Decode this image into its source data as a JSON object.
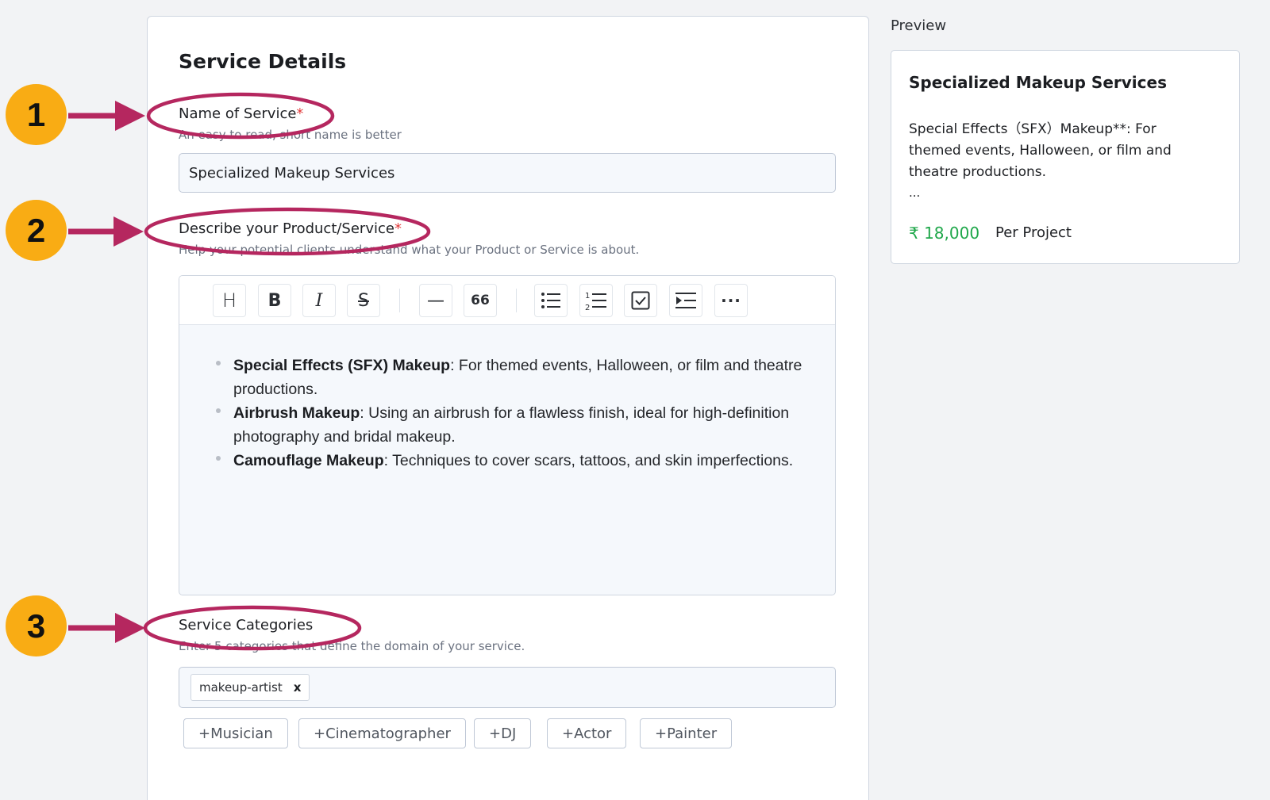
{
  "form": {
    "title": "Service Details",
    "name_field": {
      "label": "Name of Service",
      "required_mark": "*",
      "hint": "An easy to read, short name is better",
      "value": "Specialized Makeup Services"
    },
    "description_field": {
      "label": "Describe your Product/Service",
      "required_mark": "*",
      "hint": "Help your potential clients understand what your Product or Service is about.",
      "toolbar": [
        {
          "name": "heading",
          "glyph": "H"
        },
        {
          "name": "bold",
          "glyph": "B"
        },
        {
          "name": "italic",
          "glyph": "I"
        },
        {
          "name": "strikethrough",
          "glyph": "S"
        },
        {
          "name": "horizontal-rule",
          "glyph": "—"
        },
        {
          "name": "quote",
          "glyph": "66"
        },
        {
          "name": "bullet-list",
          "glyph": ""
        },
        {
          "name": "numbered-list",
          "glyph": ""
        },
        {
          "name": "checklist",
          "glyph": ""
        },
        {
          "name": "indent",
          "glyph": ""
        },
        {
          "name": "more",
          "glyph": "···"
        }
      ],
      "items": [
        {
          "bold": "Special Effects (SFX) Makeup",
          "rest": ": For themed events, Halloween, or film and theatre productions."
        },
        {
          "bold": "Airbrush Makeup",
          "rest": ": Using an airbrush for a flawless finish, ideal for high-definition photography and bridal makeup."
        },
        {
          "bold": "Camouflage Makeup",
          "rest": ": Techniques to cover scars, tattoos, and skin imperfections."
        }
      ]
    },
    "categories_field": {
      "label": "Service Categories",
      "hint": "Enter 5 categories that define the domain of your service.",
      "tags": [
        {
          "label": "makeup-artist",
          "remove": "x"
        }
      ],
      "suggestions": [
        "+Musician",
        "+Cinematographer",
        "+DJ",
        "+Actor",
        "+Painter"
      ]
    }
  },
  "preview": {
    "label": "Preview",
    "title": "Specialized Makeup Services",
    "description": "Special Effects（SFX）Makeup**: For themed events, Halloween, or film and theatre productions.",
    "ellipsis": "...",
    "price": "₹ 18,000",
    "unit": "Per Project"
  },
  "annotations": {
    "markers": [
      "1",
      "2",
      "3"
    ],
    "marker_color": "#f9ac14",
    "arrow_color": "#b5275f"
  },
  "colors": {
    "required": "#e23a3a",
    "price": "#1fa74a"
  }
}
